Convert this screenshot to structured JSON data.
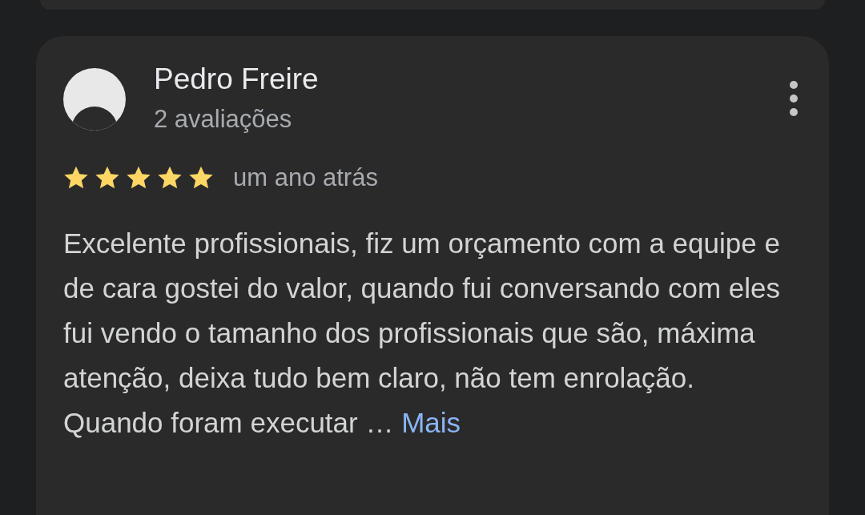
{
  "review": {
    "author": "Pedro Freire",
    "author_meta": "2 avaliações",
    "stars": 5,
    "time": "um ano atrás",
    "text": "Excelente profissionais, fiz um orçamento com a equipe e de cara gostei do valor, quando fui conversando com eles fui vendo o tamanho dos profissionais que são, máxima atenção, deixa tudo bem claro, não tem enrolação. Quando foram executar …",
    "more_link": "Mais"
  }
}
